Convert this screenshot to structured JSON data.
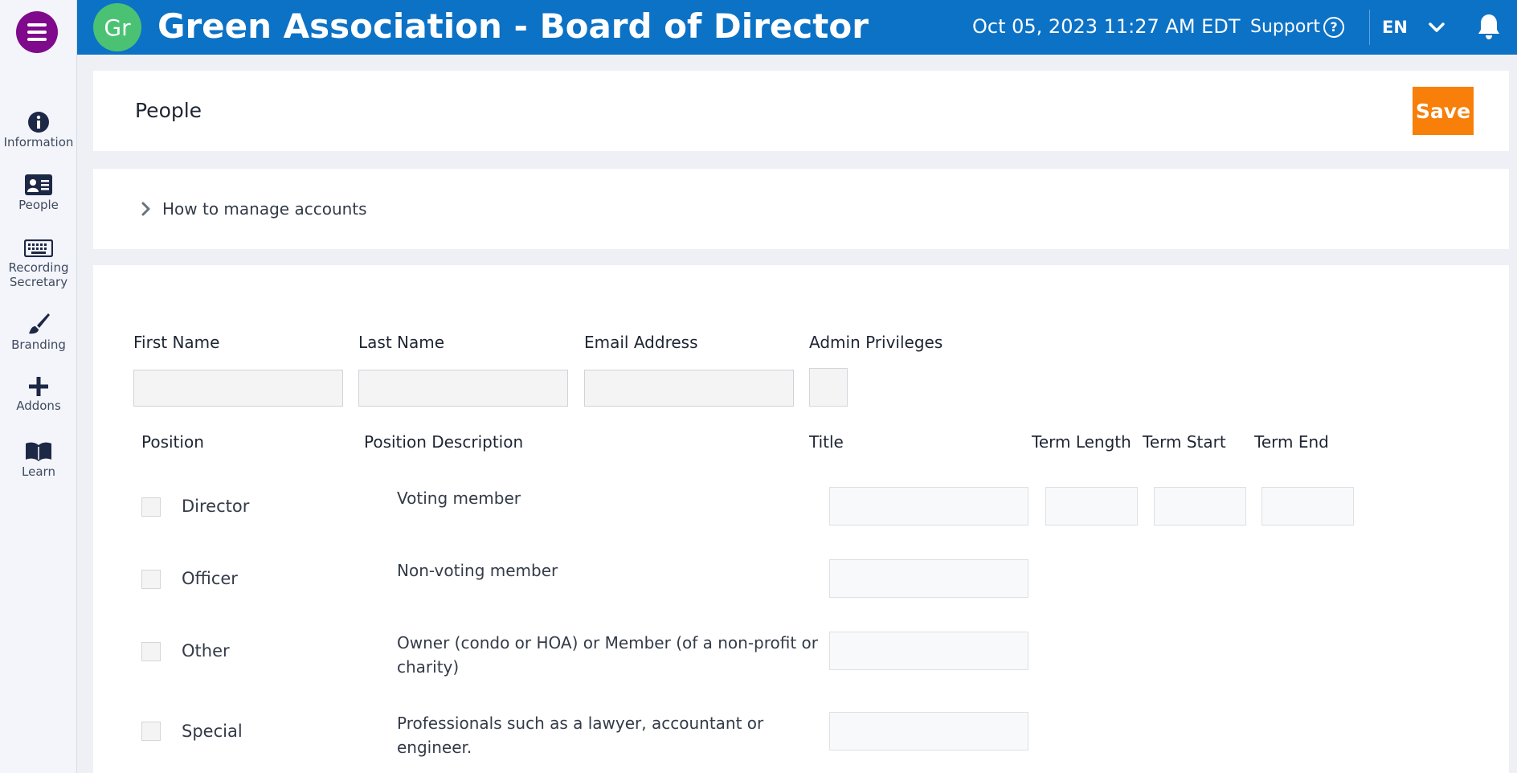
{
  "sidebar": {
    "items": [
      {
        "label": "Information"
      },
      {
        "label": "People"
      },
      {
        "label": "Recording Secretary"
      },
      {
        "label": "Branding"
      },
      {
        "label": "Addons"
      },
      {
        "label": "Learn"
      }
    ]
  },
  "header": {
    "avatar_initials": "Gr",
    "org_title": "Green Association - Board of Director",
    "datetime": "Oct 05, 2023 11:27 AM  EDT",
    "support_label": "Support",
    "language": "EN"
  },
  "page": {
    "title": "People",
    "save_label": "Save"
  },
  "help": {
    "label": "How to manage accounts"
  },
  "form": {
    "labels": {
      "first_name": "First Name",
      "last_name": "Last Name",
      "email": "Email Address",
      "admin": "Admin Privileges",
      "position": "Position",
      "position_description": "Position Description",
      "title": "Title",
      "term_length": "Term Length",
      "term_start": "Term Start",
      "term_end": "Term End"
    },
    "values": {
      "first_name": "",
      "last_name": "",
      "email": ""
    },
    "positions": [
      {
        "name": "Director",
        "description": "Voting member"
      },
      {
        "name": "Officer",
        "description": "Non-voting member"
      },
      {
        "name": "Other",
        "description": "Owner (condo or HOA) or Member (of a non-profit or charity)"
      },
      {
        "name": "Special",
        "description": "Professionals such as a lawyer, accountant or engineer."
      }
    ]
  },
  "colors": {
    "header_bg": "#0c72c6",
    "menu_button": "#7f0a8c",
    "avatar": "#4bc273",
    "save_button": "#f77f0a"
  }
}
